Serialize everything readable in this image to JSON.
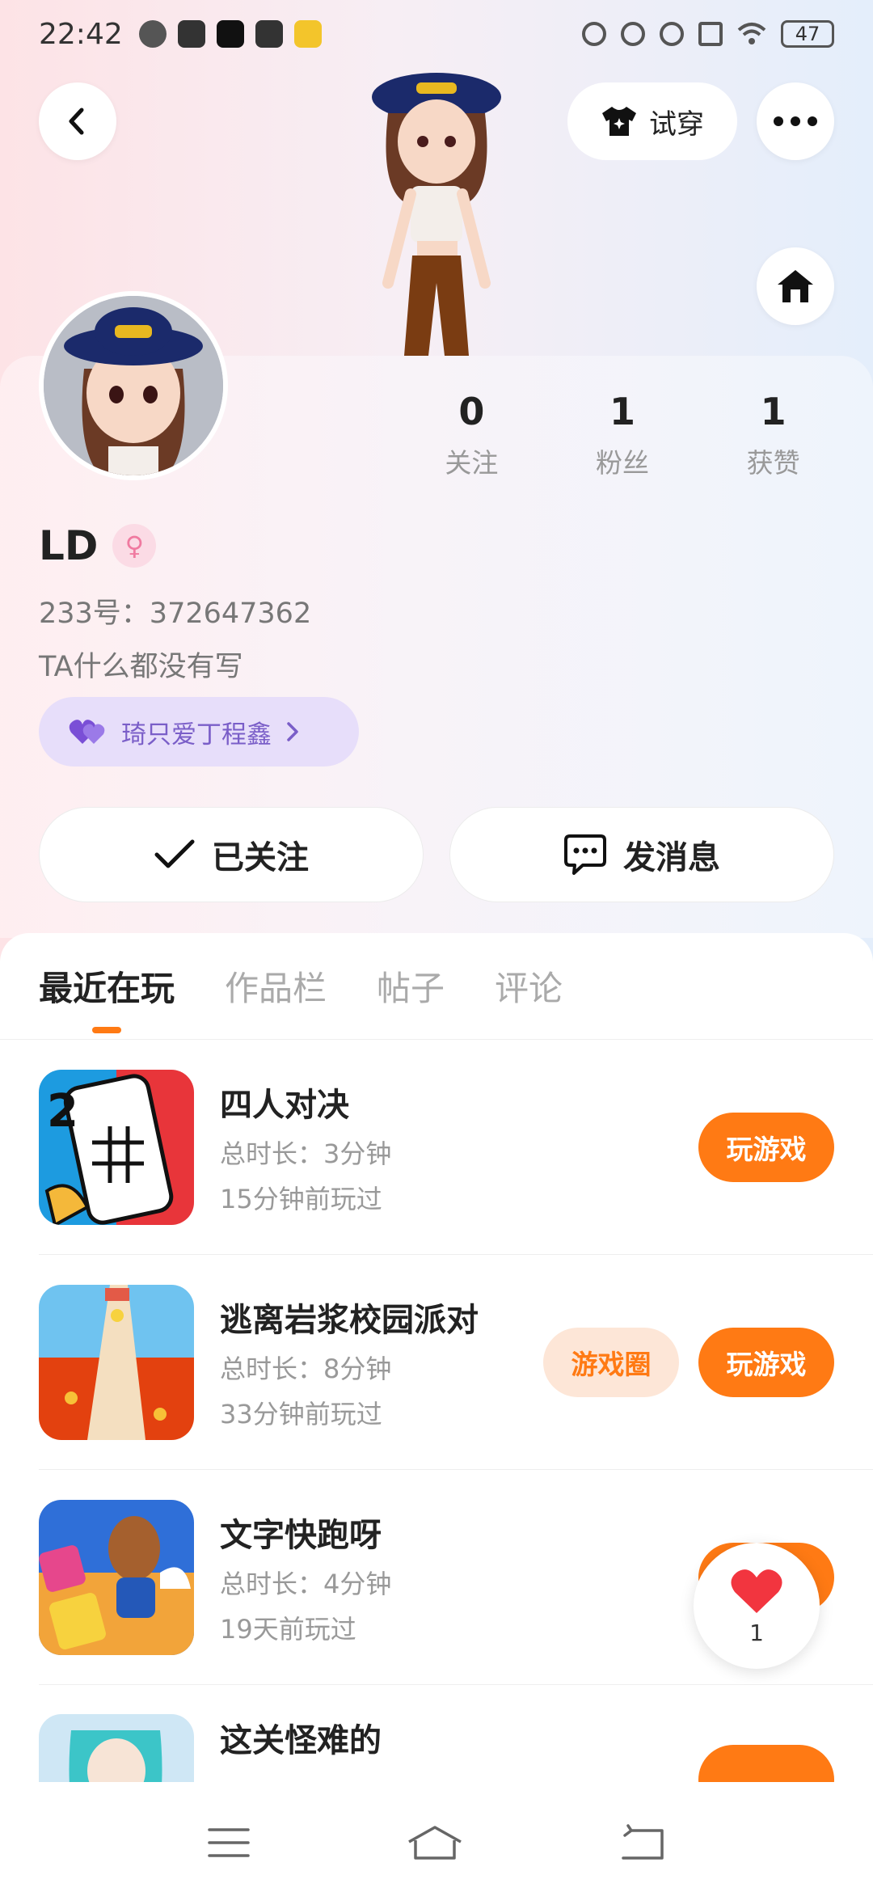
{
  "status_bar": {
    "time": "22:42",
    "battery": "47"
  },
  "header": {
    "tryon_label": "试穿"
  },
  "profile": {
    "name": "LD",
    "gender_symbol": "♀",
    "uid": "233号：372647362",
    "bio": "TA什么都没有写",
    "relation_label": "琦只爱丁程鑫",
    "stats": [
      {
        "value": "0",
        "label": "关注"
      },
      {
        "value": "1",
        "label": "粉丝"
      },
      {
        "value": "1",
        "label": "获赞"
      }
    ],
    "follow_label": "已关注",
    "message_label": "发消息"
  },
  "tabs": [
    "最近在玩",
    "作品栏",
    "帖子",
    "评论"
  ],
  "games": [
    {
      "title": "四人对决",
      "duration": "总时长：3分钟",
      "last_played": "15分钟前玩过",
      "play_label": "玩游戏",
      "circle_label": ""
    },
    {
      "title": "逃离岩浆校园派对",
      "duration": "总时长：8分钟",
      "last_played": "33分钟前玩过",
      "play_label": "玩游戏",
      "circle_label": "游戏圈"
    },
    {
      "title": "文字快跑呀",
      "duration": "总时长：4分钟",
      "last_played": "19天前玩过",
      "play_label": "",
      "circle_label": ""
    },
    {
      "title": "这关怪难的",
      "duration": "",
      "last_played": "",
      "play_label": "",
      "circle_label": ""
    }
  ],
  "like": {
    "count": "1"
  },
  "colors": {
    "accent": "#ff7a14",
    "chip_bg": "#e7defa",
    "chip_text": "#7a5ec8"
  }
}
